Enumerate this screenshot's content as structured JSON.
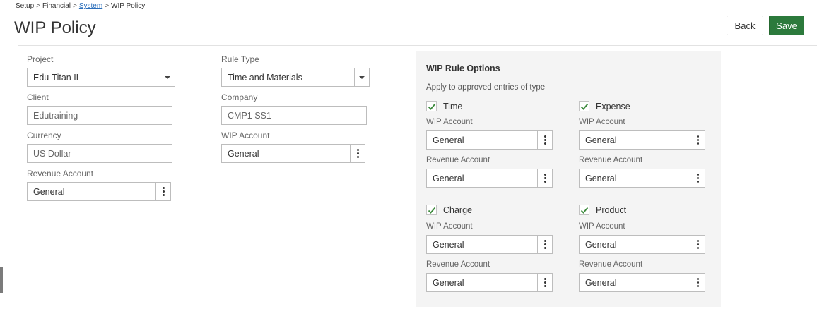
{
  "breadcrumb": {
    "setup": "Setup",
    "financial": "Financial",
    "system": "System",
    "current": "WIP Policy",
    "separator": ">"
  },
  "page": {
    "title": "WIP Policy"
  },
  "actions": {
    "back": "Back",
    "save": "Save"
  },
  "form": {
    "project": {
      "label": "Project",
      "value": "Edu-Titan II"
    },
    "rule_type": {
      "label": "Rule Type",
      "value": "Time and Materials"
    },
    "client": {
      "label": "Client",
      "value": "Edutraining"
    },
    "company": {
      "label": "Company",
      "value": "CMP1 SS1"
    },
    "currency": {
      "label": "Currency",
      "value": "US Dollar"
    },
    "wip_account": {
      "label": "WIP Account",
      "value": "General"
    },
    "revenue_account": {
      "label": "Revenue Account",
      "value": "General"
    }
  },
  "options": {
    "title": "WIP Rule Options",
    "subtitle": "Apply to approved entries of type",
    "wip_label": "WIP Account",
    "revenue_label": "Revenue Account",
    "time": {
      "label": "Time",
      "checked": true,
      "wip": "General",
      "revenue": "General"
    },
    "expense": {
      "label": "Expense",
      "checked": true,
      "wip": "General",
      "revenue": "General"
    },
    "charge": {
      "label": "Charge",
      "checked": true,
      "wip": "General",
      "revenue": "General"
    },
    "product": {
      "label": "Product",
      "checked": true,
      "wip": "General",
      "revenue": "General"
    }
  },
  "colors": {
    "accent": "#2c7a3c",
    "link": "#2a6ebb",
    "check": "#3c8a3c"
  },
  "icons": {
    "dropdown": "caret-down-icon",
    "picker": "more-vertical-icon",
    "check": "checkmark-icon"
  }
}
